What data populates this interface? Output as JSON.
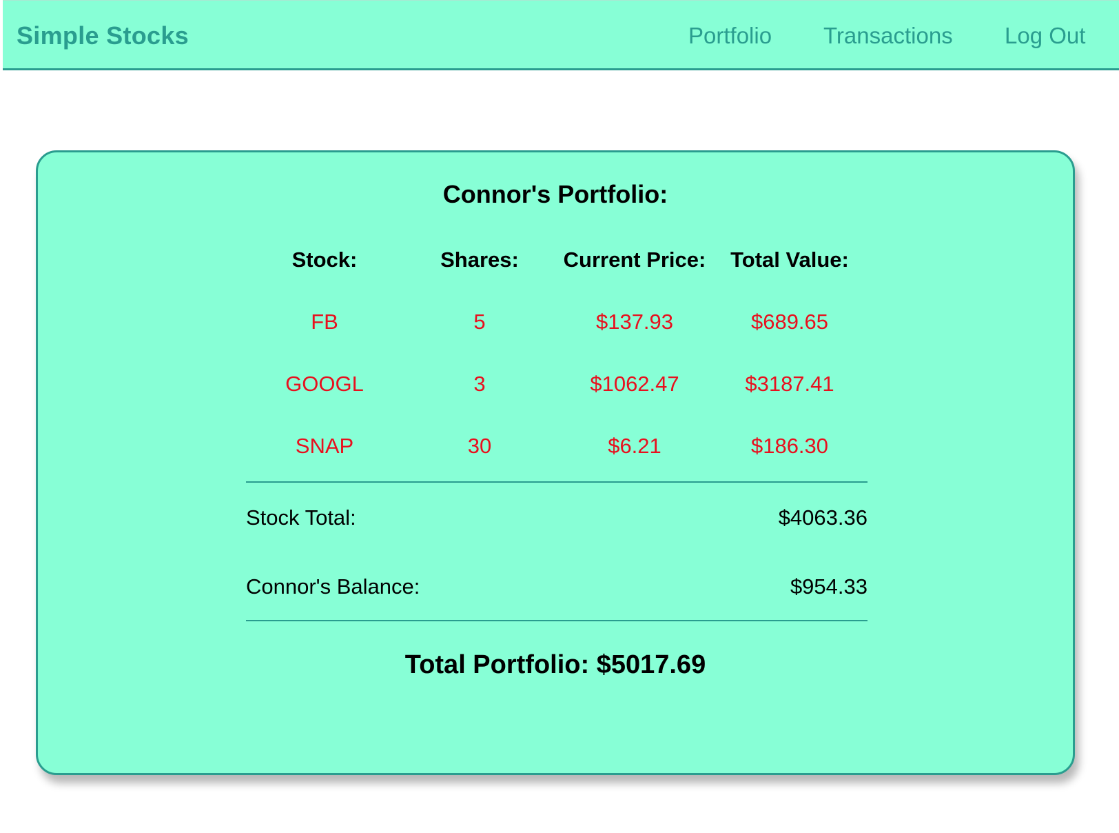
{
  "navbar": {
    "brand": "Simple Stocks",
    "links": [
      "Portfolio",
      "Transactions",
      "Log Out"
    ]
  },
  "portfolio": {
    "title": "Connor's Portfolio:",
    "headers": [
      "Stock:",
      "Shares:",
      "Current Price:",
      "Total Value:"
    ],
    "rows": [
      [
        "FB",
        "5",
        "$137.93",
        "$689.65"
      ],
      [
        "GOOGL",
        "3",
        "$1062.47",
        "$3187.41"
      ],
      [
        "SNAP",
        "30",
        "$6.21",
        "$186.30"
      ]
    ],
    "stock_total_label": "Stock Total:",
    "stock_total_value": "$4063.36",
    "balance_label": "Connor's Balance:",
    "balance_value": "$954.33",
    "grand_total": "Total Portfolio: $5017.69"
  },
  "colors": {
    "accent_background": "#87ffd6",
    "accent_dark": "#2a9d8f",
    "row_text": "#e8101e"
  }
}
